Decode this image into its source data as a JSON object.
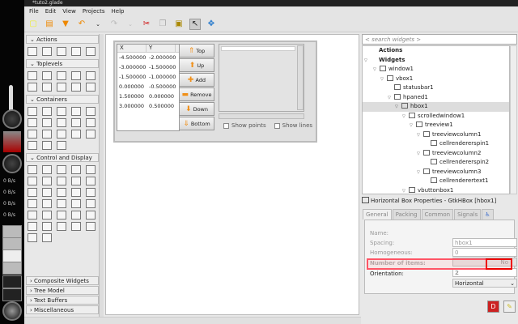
{
  "window": {
    "title": "*tuto2.glade"
  },
  "menu": [
    "File",
    "Edit",
    "View",
    "Projects",
    "Help"
  ],
  "dock": {
    "rates": [
      "0 B/s",
      "0 B/s",
      "0 B/s",
      "0 B/s"
    ]
  },
  "palette": {
    "sections": [
      "Actions",
      "Toplevels",
      "Containers",
      "Control and Display"
    ],
    "collapsed": [
      "Composite Widgets",
      "Tree Model",
      "Text Buffers",
      "Miscellaneous"
    ],
    "icon_counts": [
      5,
      10,
      18,
      32
    ]
  },
  "design": {
    "columns": [
      "X",
      "Y"
    ],
    "rows": [
      [
        "-4.500000",
        "-2.000000"
      ],
      [
        "-3.000000",
        "-1.500000"
      ],
      [
        "-1.500000",
        "-1.000000"
      ],
      [
        "0.000000",
        "-0.500000"
      ],
      [
        "1.500000",
        "0.000000"
      ],
      [
        "3.000000",
        "0.500000"
      ]
    ],
    "buttons": [
      {
        "label": "Top",
        "icon": "⇑"
      },
      {
        "label": "Up",
        "icon": "⬆"
      },
      {
        "label": "Add",
        "icon": "✚"
      },
      {
        "label": "Remove",
        "icon": "▬"
      },
      {
        "label": "Down",
        "icon": "⬇"
      },
      {
        "label": "Bottom",
        "icon": "⇓"
      }
    ],
    "show_points": "Show points",
    "show_lines": "Show lines"
  },
  "inspector": {
    "search_placeholder": "< search widgets >",
    "tree": [
      {
        "label": "Actions",
        "depth": 0,
        "bold": true,
        "arrow": false,
        "icon": false
      },
      {
        "label": "Widgets",
        "depth": 0,
        "bold": true,
        "arrow": true,
        "icon": false
      },
      {
        "label": "window1",
        "depth": 1,
        "arrow": true,
        "icon": true
      },
      {
        "label": "vbox1",
        "depth": 2,
        "arrow": true,
        "icon": true
      },
      {
        "label": "statusbar1",
        "depth": 3,
        "arrow": false,
        "icon": true
      },
      {
        "label": "hpaned1",
        "depth": 3,
        "arrow": true,
        "icon": true
      },
      {
        "label": "hbox1",
        "depth": 4,
        "arrow": true,
        "icon": true,
        "selected": true
      },
      {
        "label": "scrolledwindow1",
        "depth": 5,
        "arrow": true,
        "icon": true
      },
      {
        "label": "treeview1",
        "depth": 6,
        "arrow": true,
        "icon": true
      },
      {
        "label": "treeviewcolumn1",
        "depth": 7,
        "arrow": true,
        "icon": true
      },
      {
        "label": "cellrendererspin1",
        "depth": 8,
        "arrow": false,
        "icon": true
      },
      {
        "label": "treeviewcolumn2",
        "depth": 7,
        "arrow": true,
        "icon": true
      },
      {
        "label": "cellrendererspin2",
        "depth": 8,
        "arrow": false,
        "icon": true
      },
      {
        "label": "treeviewcolumn3",
        "depth": 7,
        "arrow": true,
        "icon": true
      },
      {
        "label": "cellrenderertext1",
        "depth": 8,
        "arrow": false,
        "icon": true
      },
      {
        "label": "vbuttonbox1",
        "depth": 5,
        "arrow": true,
        "icon": true
      }
    ]
  },
  "properties": {
    "title": "Horizontal Box Properties - GtkHBox [hbox1]",
    "tabs": [
      "General",
      "Packing",
      "Common",
      "Signals"
    ],
    "rows": [
      {
        "label": "Name:",
        "value": "hbox1"
      },
      {
        "label": "Spacing:",
        "value": "0"
      },
      {
        "label": "Homogeneous:",
        "value": "No"
      },
      {
        "label": "Number of items:",
        "value": "2"
      },
      {
        "label": "Orientation:",
        "value": "Horizontal"
      }
    ],
    "highlight_color": "#ee0000"
  }
}
